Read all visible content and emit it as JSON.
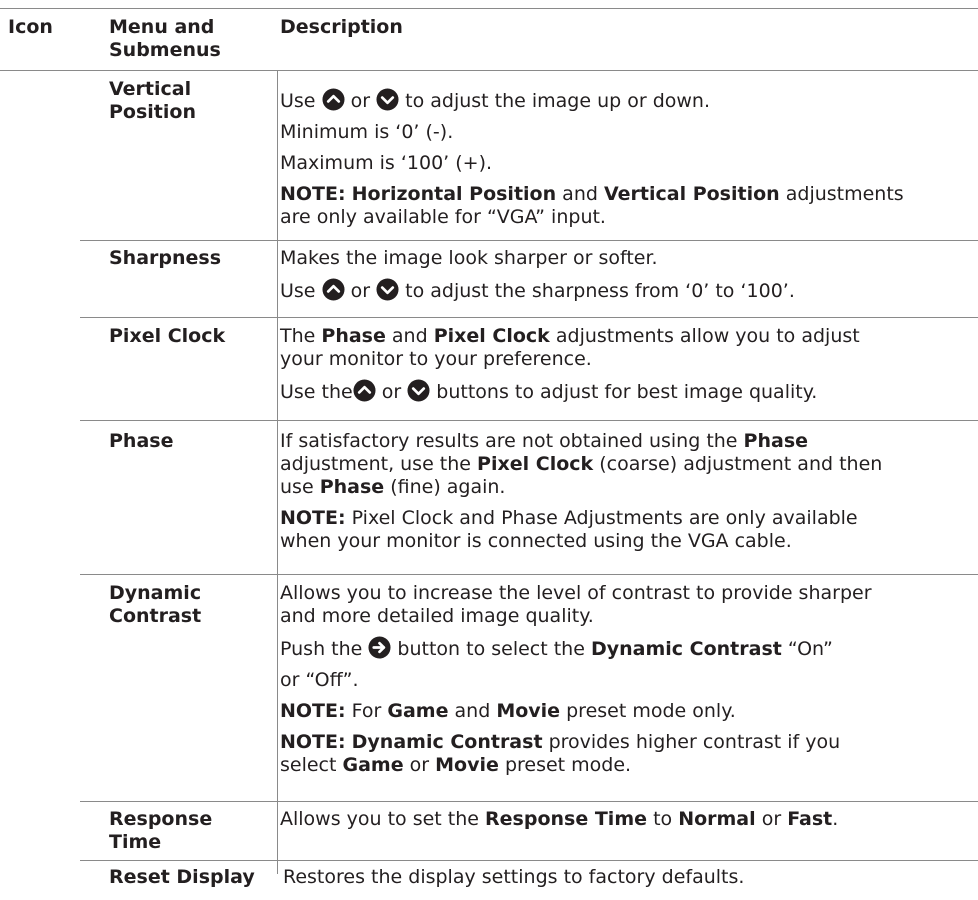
{
  "header": {
    "icon": "Icon",
    "menu_line1": "Menu and",
    "menu_line2": "Submenus",
    "description": "Description"
  },
  "icons": {
    "up": "chevron-up-circle-icon",
    "down": "chevron-down-circle-icon",
    "right": "arrow-right-circle-icon",
    "color": "#231f20"
  },
  "rows": {
    "vertical_position": {
      "menu_line1": "Vertical",
      "menu_line2": "Position",
      "use": "Use",
      "or": "or",
      "adjust": "to adjust the image up or down.",
      "minimum": "Minimum is ‘0’ (-).",
      "maximum": "Maximum is ‘100’ (+).",
      "note_label": "NOTE:",
      "note_term1": "Horizontal Position",
      "and": "and",
      "note_term2": "Vertical Position",
      "note_rest1": "adjustments",
      "note_rest2": "are only available for “VGA” input."
    },
    "sharpness": {
      "menu": "Sharpness",
      "line1": "Makes the image look sharper or softer.",
      "use": "Use",
      "or": "or",
      "adjust": "to adjust the sharpness from ‘0’ to ‘100’."
    },
    "pixel_clock": {
      "menu": "Pixel Clock",
      "the": "The",
      "term1": "Phase",
      "and": "and",
      "term2": "Pixel Clock",
      "rest1": "adjustments allow you to adjust",
      "line2": "your monitor to your preference.",
      "use_the": "Use the",
      "or": "or",
      "buttons": "buttons to adjust for best image quality."
    },
    "phase": {
      "menu": "Phase",
      "l1a": "If satisfactory results are not obtained using the",
      "l1b": "Phase",
      "l2a": "adjustment, use the",
      "l2b": "Pixel Clock",
      "l2c": "(coarse) adjustment and then",
      "l3a": "use",
      "l3b": "Phase",
      "l3c": "(fine) again.",
      "note_label": "NOTE:",
      "note1": "Pixel Clock and Phase Adjustments are only available",
      "note2": "when your monitor is connected using the VGA cable."
    },
    "dynamic_contrast": {
      "menu_line1": "Dynamic",
      "menu_line2": "Contrast",
      "line1": "Allows you to increase the level of contrast to provide sharper",
      "line2": "and more detailed image quality.",
      "push": "Push the",
      "button_to_select": "button to select the",
      "term": "Dynamic Contrast",
      "on": "“On”",
      "off": "or “Off”.",
      "note1_label": "NOTE:",
      "note1_for": "For",
      "note1_game": "Game",
      "and": "and",
      "note1_movie": "Movie",
      "note1_rest": "preset mode only.",
      "note2_label": "NOTE:",
      "note2_term": "Dynamic Contrast",
      "note2_rest1": "provides higher contrast if you",
      "note2_select": "select",
      "note2_game": "Game",
      "or": "or",
      "note2_movie": "Movie",
      "note2_rest2": "preset mode."
    },
    "response_time": {
      "menu_line1": "Response",
      "menu_line2": "Time",
      "allows": "Allows you to set the",
      "term": "Response Time",
      "to": "to",
      "normal": "Normal",
      "or": "or",
      "fast": "Fast",
      "period": "."
    },
    "reset_display": {
      "menu": "Reset Display",
      "line1": "Restores the display settings to factory defaults."
    }
  }
}
